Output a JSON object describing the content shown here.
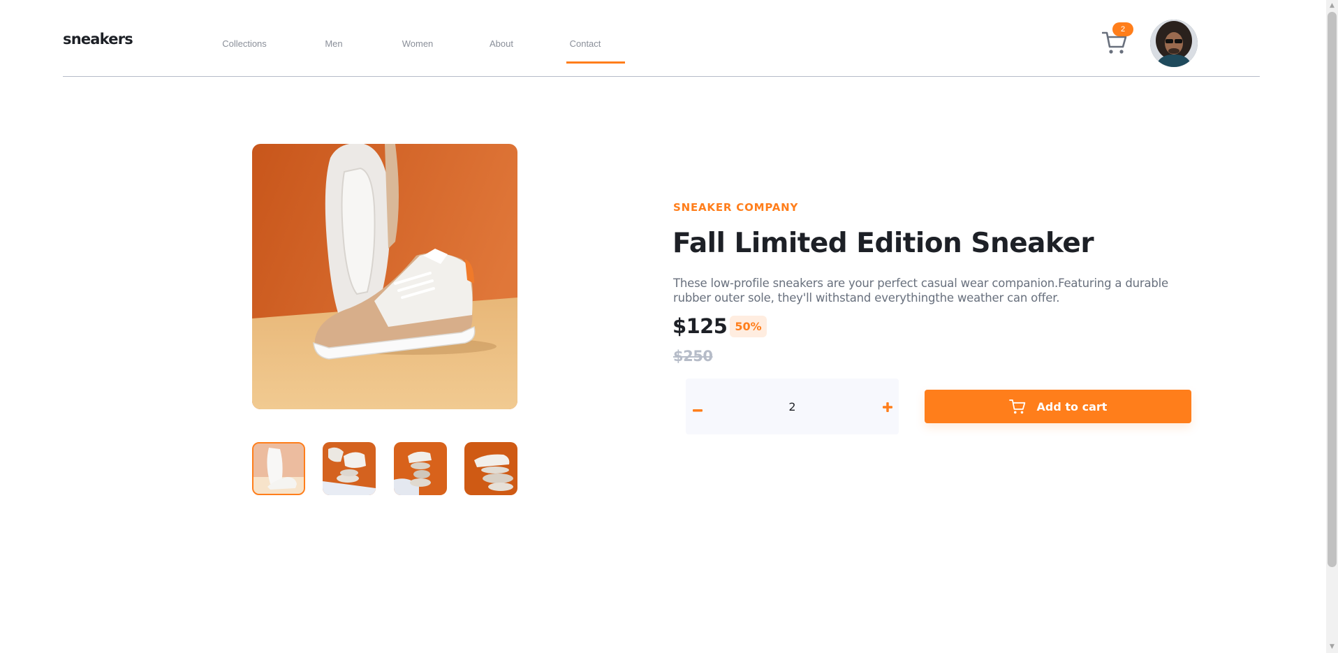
{
  "header": {
    "logo": "sneakers",
    "nav": [
      {
        "label": "Collections"
      },
      {
        "label": "Men"
      },
      {
        "label": "Women"
      },
      {
        "label": "About"
      },
      {
        "label": "Contact",
        "active": true
      }
    ],
    "cart_count": "2"
  },
  "product": {
    "company": "SNEAKER COMPANY",
    "title": "Fall Limited Edition Sneaker",
    "description": "These low-profile sneakers are your perfect casual wear companion.Featuring a durable rubber outer sole, they'll withstand everythingthe weather can offer.",
    "price": "$125",
    "discount": "50%",
    "original_price": "$250",
    "quantity": "2",
    "add_to_cart_label": "Add to cart"
  },
  "colors": {
    "accent": "#ff7e1b",
    "accent_pale": "#ffede0",
    "text_dark": "#1d2026",
    "text_muted": "#68707d"
  },
  "icons": {
    "cart": "cart-icon",
    "minus": "minus-icon",
    "plus": "plus-icon"
  }
}
